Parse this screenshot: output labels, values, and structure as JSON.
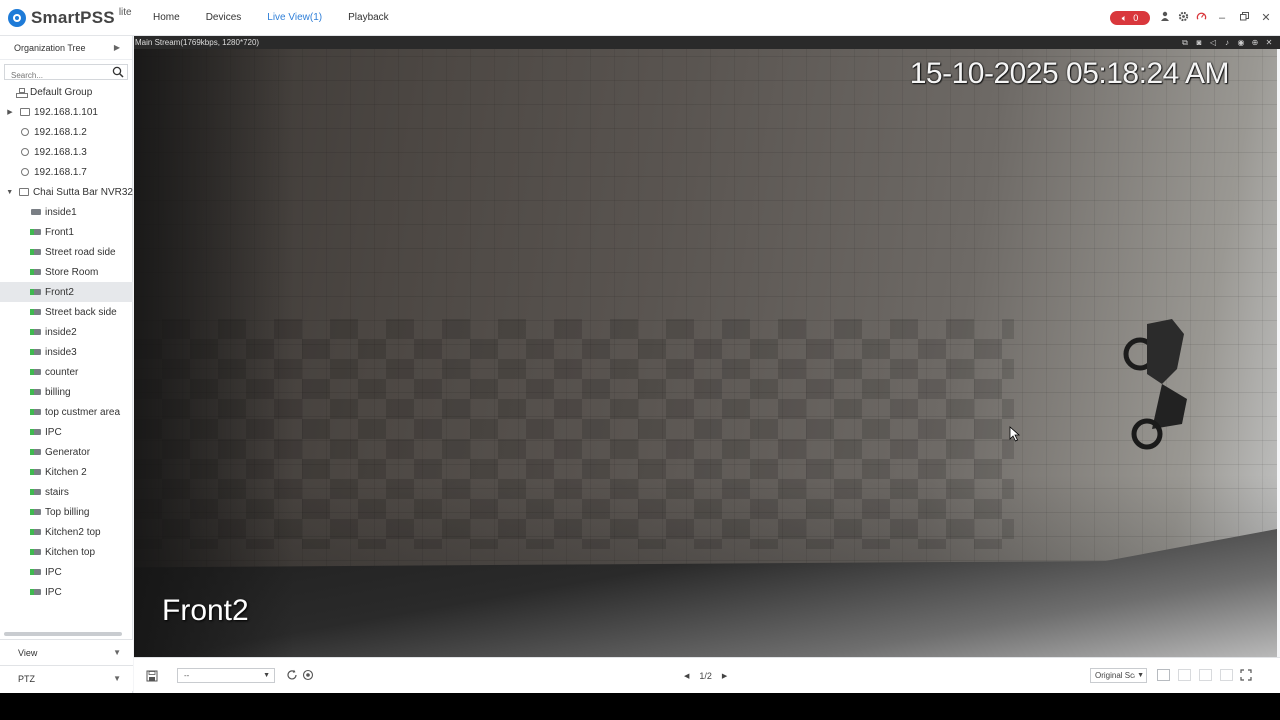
{
  "app": {
    "name": "SmartPSS",
    "edition": "lite"
  },
  "nav": {
    "items": [
      {
        "label": "Home",
        "active": false
      },
      {
        "label": "Devices",
        "active": false
      },
      {
        "label": "Live View(1)",
        "active": true
      },
      {
        "label": "Playback",
        "active": false
      }
    ]
  },
  "titlebar": {
    "alarm_count": "0",
    "icons": [
      "sound-icon",
      "user-icon",
      "gear-icon",
      "performance-icon"
    ],
    "window_controls": [
      "minimize",
      "restore",
      "close"
    ]
  },
  "sidebar": {
    "header": "Organization Tree",
    "search_placeholder": "Search...",
    "tree": [
      {
        "label": "Default Group",
        "type": "group",
        "level": 0
      },
      {
        "label": "192.168.1.101",
        "type": "device",
        "level": 1,
        "expander": "▶"
      },
      {
        "label": "192.168.1.2",
        "type": "ring",
        "level": 1
      },
      {
        "label": "192.168.1.3",
        "type": "ring",
        "level": 1
      },
      {
        "label": "192.168.1.7",
        "type": "ring",
        "level": 1
      },
      {
        "label": "Chai Sutta Bar NVR32",
        "type": "device",
        "level": 1,
        "expander": "▼"
      },
      {
        "label": "inside1",
        "type": "camera",
        "level": 2,
        "online": false
      },
      {
        "label": "Front1",
        "type": "camera",
        "level": 2,
        "online": true
      },
      {
        "label": "Street road side",
        "type": "camera",
        "level": 2,
        "online": true
      },
      {
        "label": "Store Room",
        "type": "camera",
        "level": 2,
        "online": true
      },
      {
        "label": "Front2",
        "type": "camera",
        "level": 2,
        "online": true,
        "selected": true
      },
      {
        "label": "Street back side",
        "type": "camera",
        "level": 2,
        "online": true
      },
      {
        "label": "inside2",
        "type": "camera",
        "level": 2,
        "online": true
      },
      {
        "label": "inside3",
        "type": "camera",
        "level": 2,
        "online": true
      },
      {
        "label": "counter",
        "type": "camera",
        "level": 2,
        "online": true
      },
      {
        "label": "billing",
        "type": "camera",
        "level": 2,
        "online": true
      },
      {
        "label": "top custmer area",
        "type": "camera",
        "level": 2,
        "online": true
      },
      {
        "label": "IPC",
        "type": "camera",
        "level": 2,
        "online": true
      },
      {
        "label": "Generator",
        "type": "camera",
        "level": 2,
        "online": true
      },
      {
        "label": "Kitchen 2",
        "type": "camera",
        "level": 2,
        "online": true
      },
      {
        "label": "stairs",
        "type": "camera",
        "level": 2,
        "online": true
      },
      {
        "label": "Top billing",
        "type": "camera",
        "level": 2,
        "online": true
      },
      {
        "label": "Kitchen2 top",
        "type": "camera",
        "level": 2,
        "online": true
      },
      {
        "label": "Kitchen top",
        "type": "camera",
        "level": 2,
        "online": true
      },
      {
        "label": "IPC",
        "type": "camera",
        "level": 2,
        "online": true
      },
      {
        "label": "IPC",
        "type": "camera",
        "level": 2,
        "online": true
      }
    ],
    "view_label": "View",
    "ptz_label": "PTZ"
  },
  "video": {
    "stream_info": "Main Stream(1769kbps, 1280*720)",
    "osd_timestamp": "15-10-2025 05:18:24 AM",
    "osd_channel": "Front2"
  },
  "controls": {
    "preset_value": "--",
    "page": "1/2",
    "scale_value": "Original Sca"
  }
}
